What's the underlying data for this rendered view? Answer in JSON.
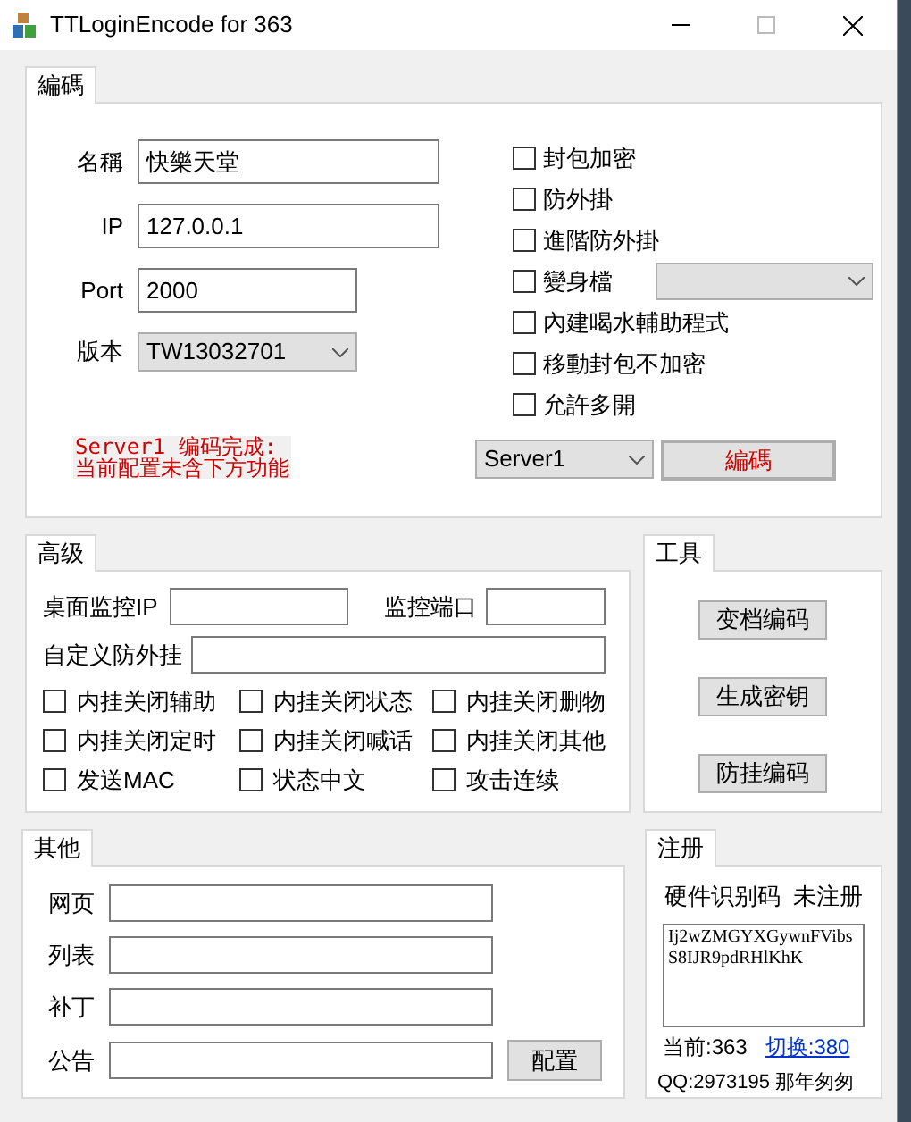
{
  "window": {
    "title": "TTLoginEncode for 363"
  },
  "encode_panel": {
    "tab": {
      "label": "編碼",
      "selected": true
    },
    "fields": [
      {
        "label": "名稱",
        "value": "快樂天堂"
      },
      {
        "label": "IP",
        "value": "127.0.0.1"
      },
      {
        "label": "Port",
        "value": "2000"
      }
    ],
    "version": {
      "label": "版本",
      "value": "TW13032701"
    },
    "options": [
      {
        "label": "封包加密",
        "checked": false
      },
      {
        "label": "防外掛",
        "checked": false
      },
      {
        "label": "進階防外掛",
        "checked": false
      },
      {
        "label": "變身檔",
        "checked": false
      },
      {
        "label": "內建喝水輔助程式",
        "checked": false
      },
      {
        "label": "移動封包不加密",
        "checked": false
      },
      {
        "label": "允許多開",
        "checked": false
      }
    ],
    "status": [
      "Server1 编码完成:",
      "当前配置未含下方功能"
    ],
    "server": {
      "value": "Server1"
    },
    "encode_button": "編碼"
  },
  "advanced_panel": {
    "tab": {
      "label": "高级",
      "selected": true
    },
    "monitor_ip": {
      "label": "桌面监控IP"
    },
    "monitor_port": {
      "label": "监控端口"
    },
    "custom_anti_cheat": {
      "label": "自定义防外挂"
    },
    "options": [
      {
        "label": "内挂关闭辅助",
        "checked": false
      },
      {
        "label": "内挂关闭状态",
        "checked": false
      },
      {
        "label": "内挂关闭删物",
        "checked": false
      },
      {
        "label": "内挂关闭定时",
        "checked": false
      },
      {
        "label": "内挂关闭喊话",
        "checked": false
      },
      {
        "label": "内挂关闭其他",
        "checked": false
      },
      {
        "label": "发送MAC",
        "checked": false
      },
      {
        "label": "状态中文",
        "checked": false
      },
      {
        "label": "攻击连续",
        "checked": false
      }
    ]
  },
  "tools_panel": {
    "tab": {
      "label": "工具",
      "selected": true
    },
    "buttons": [
      "变档编码",
      "生成密钥",
      "防挂编码"
    ]
  },
  "other_panel": {
    "tab": {
      "label": "其他",
      "selected": true
    },
    "fields": [
      {
        "label": "网页"
      },
      {
        "label": "列表"
      },
      {
        "label": "补丁"
      },
      {
        "label": "公告"
      }
    ],
    "config_button": "配置"
  },
  "register_panel": {
    "tab": {
      "label": "注册",
      "selected": true
    },
    "hardware_id_label": "硬件识别码",
    "register_status": "未注册",
    "hardware_id": "Ij2wZMGYXGywnFVibs S8IJR9pdRHlKhK",
    "current": "当前:363",
    "switch_link": "切换:380",
    "contact": "QQ:2973195 那年匆匆"
  }
}
